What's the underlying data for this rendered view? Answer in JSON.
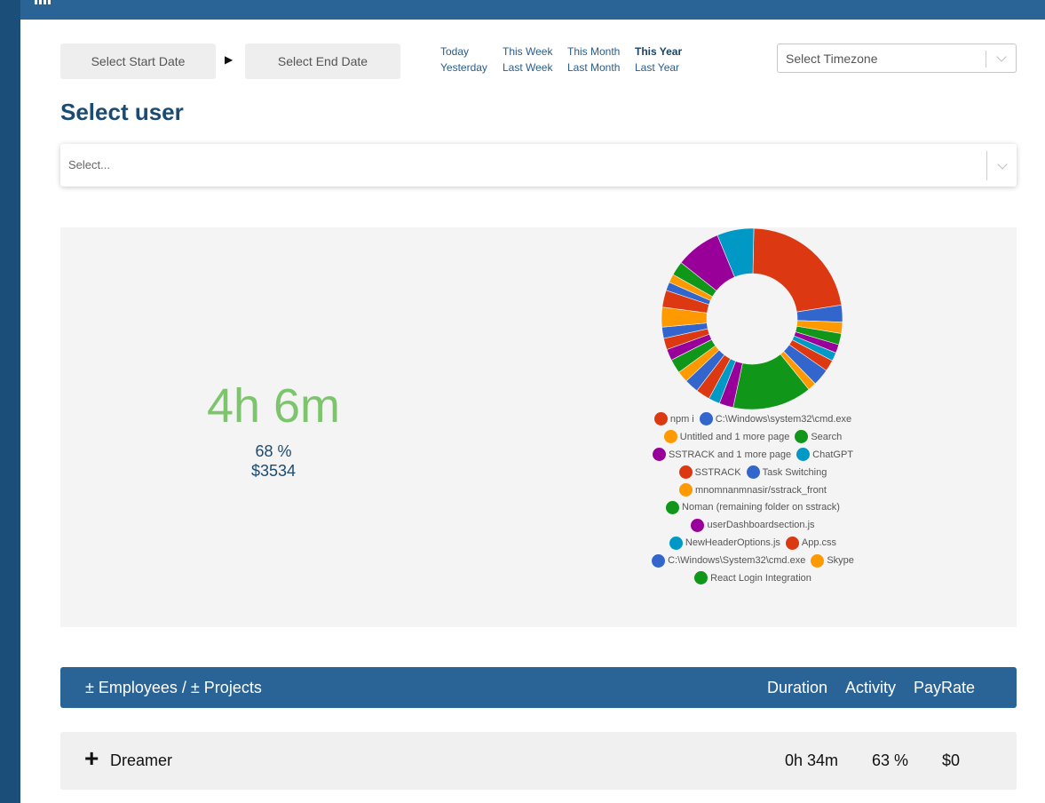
{
  "header": {
    "title": ""
  },
  "date_range": {
    "start_label": "Select Start Date",
    "end_label": "Select End Date",
    "separator": "▶"
  },
  "quick_ranges": {
    "today": "Today",
    "yesterday": "Yesterday",
    "this_week": "This Week",
    "last_week": "Last Week",
    "this_month": "This Month",
    "last_month": "Last Month",
    "this_year": "This Year",
    "last_year": "Last Year",
    "active": "This Year"
  },
  "timezone": {
    "placeholder": "Select Timezone"
  },
  "user_section": {
    "title": "Select user",
    "placeholder": "Select..."
  },
  "summary": {
    "total_time": "4h 6m",
    "activity_percent": "68 %",
    "total_pay": "$3534"
  },
  "chart_data": {
    "type": "pie",
    "variant": "donut",
    "series": [
      {
        "name": "npm i",
        "color": "#dc3912",
        "value": 22.0
      },
      {
        "name": "C:\\Windows\\system32\\cmd.exe",
        "color": "#3366cc",
        "value": 3.0
      },
      {
        "name": "Untitled and 1 more page",
        "color": "#ff9900",
        "value": 2.0
      },
      {
        "name": "Search",
        "color": "#109618",
        "value": 2.0
      },
      {
        "name": "SSTRACK and 1 more page",
        "color": "#990099",
        "value": 1.5
      },
      {
        "name": "ChatGPT",
        "color": "#0099c6",
        "value": 1.5
      },
      {
        "name": "SSTRACK",
        "color": "#dc3912",
        "value": 2.0
      },
      {
        "name": "Task Switching",
        "color": "#3366cc",
        "value": 3.0
      },
      {
        "name": "mnomnanmnasir/sstrack_front",
        "color": "#ff9900",
        "value": 1.5
      },
      {
        "name": "Noman (remaining folder on sstrack)",
        "color": "#109618",
        "value": 14.0
      },
      {
        "name": "userDashboardsection.js",
        "color": "#990099",
        "value": 2.5
      },
      {
        "name": "NewHeaderOptions.js",
        "color": "#0099c6",
        "value": 2.0
      },
      {
        "name": "App.css",
        "color": "#dc3912",
        "value": 2.5
      },
      {
        "name": "C:\\Windows\\System32\\cmd.exe",
        "color": "#3366cc",
        "value": 2.5
      },
      {
        "name": "Skype",
        "color": "#ff9900",
        "value": 2.0
      },
      {
        "name": "React Login Integration",
        "color": "#109618",
        "value": 2.5
      },
      {
        "name": "",
        "color": "#990099",
        "value": 2.0
      },
      {
        "name": "",
        "color": "#dc3912",
        "value": 2.0
      },
      {
        "name": "",
        "color": "#3366cc",
        "value": 2.0
      },
      {
        "name": "",
        "color": "#ff9900",
        "value": 3.5
      },
      {
        "name": "",
        "color": "#dc3912",
        "value": 3.0
      },
      {
        "name": "",
        "color": "#3366cc",
        "value": 1.5
      },
      {
        "name": "",
        "color": "#ff9900",
        "value": 1.5
      },
      {
        "name": "",
        "color": "#109618",
        "value": 2.5
      },
      {
        "name": "",
        "color": "#990099",
        "value": 8.0
      },
      {
        "name": "",
        "color": "#0099c6",
        "value": 6.5
      }
    ]
  },
  "legend_rows": [
    [
      "npm i",
      "C:\\Windows\\system32\\cmd.exe"
    ],
    [
      "Untitled and 1 more page",
      "Search"
    ],
    [
      "SSTRACK and 1 more page",
      "ChatGPT"
    ],
    [
      "SSTRACK",
      "Task Switching"
    ],
    [
      "mnomnanmnasir/sstrack_front"
    ],
    [
      "Noman (remaining folder on sstrack)"
    ],
    [
      "userDashboardsection.js"
    ],
    [
      "NewHeaderOptions.js",
      "App.css"
    ],
    [
      "C:\\Windows\\System32\\cmd.exe",
      "Skype"
    ],
    [
      "React Login Integration"
    ]
  ],
  "table": {
    "header": {
      "name": "± Employees / ± Projects",
      "duration": "Duration",
      "activity": "Activity",
      "payrate": "PayRate"
    },
    "rows": [
      {
        "expand": "+",
        "name": "Dreamer",
        "duration": "0h 34m",
        "activity": "63 %",
        "payrate": "$0"
      }
    ]
  }
}
